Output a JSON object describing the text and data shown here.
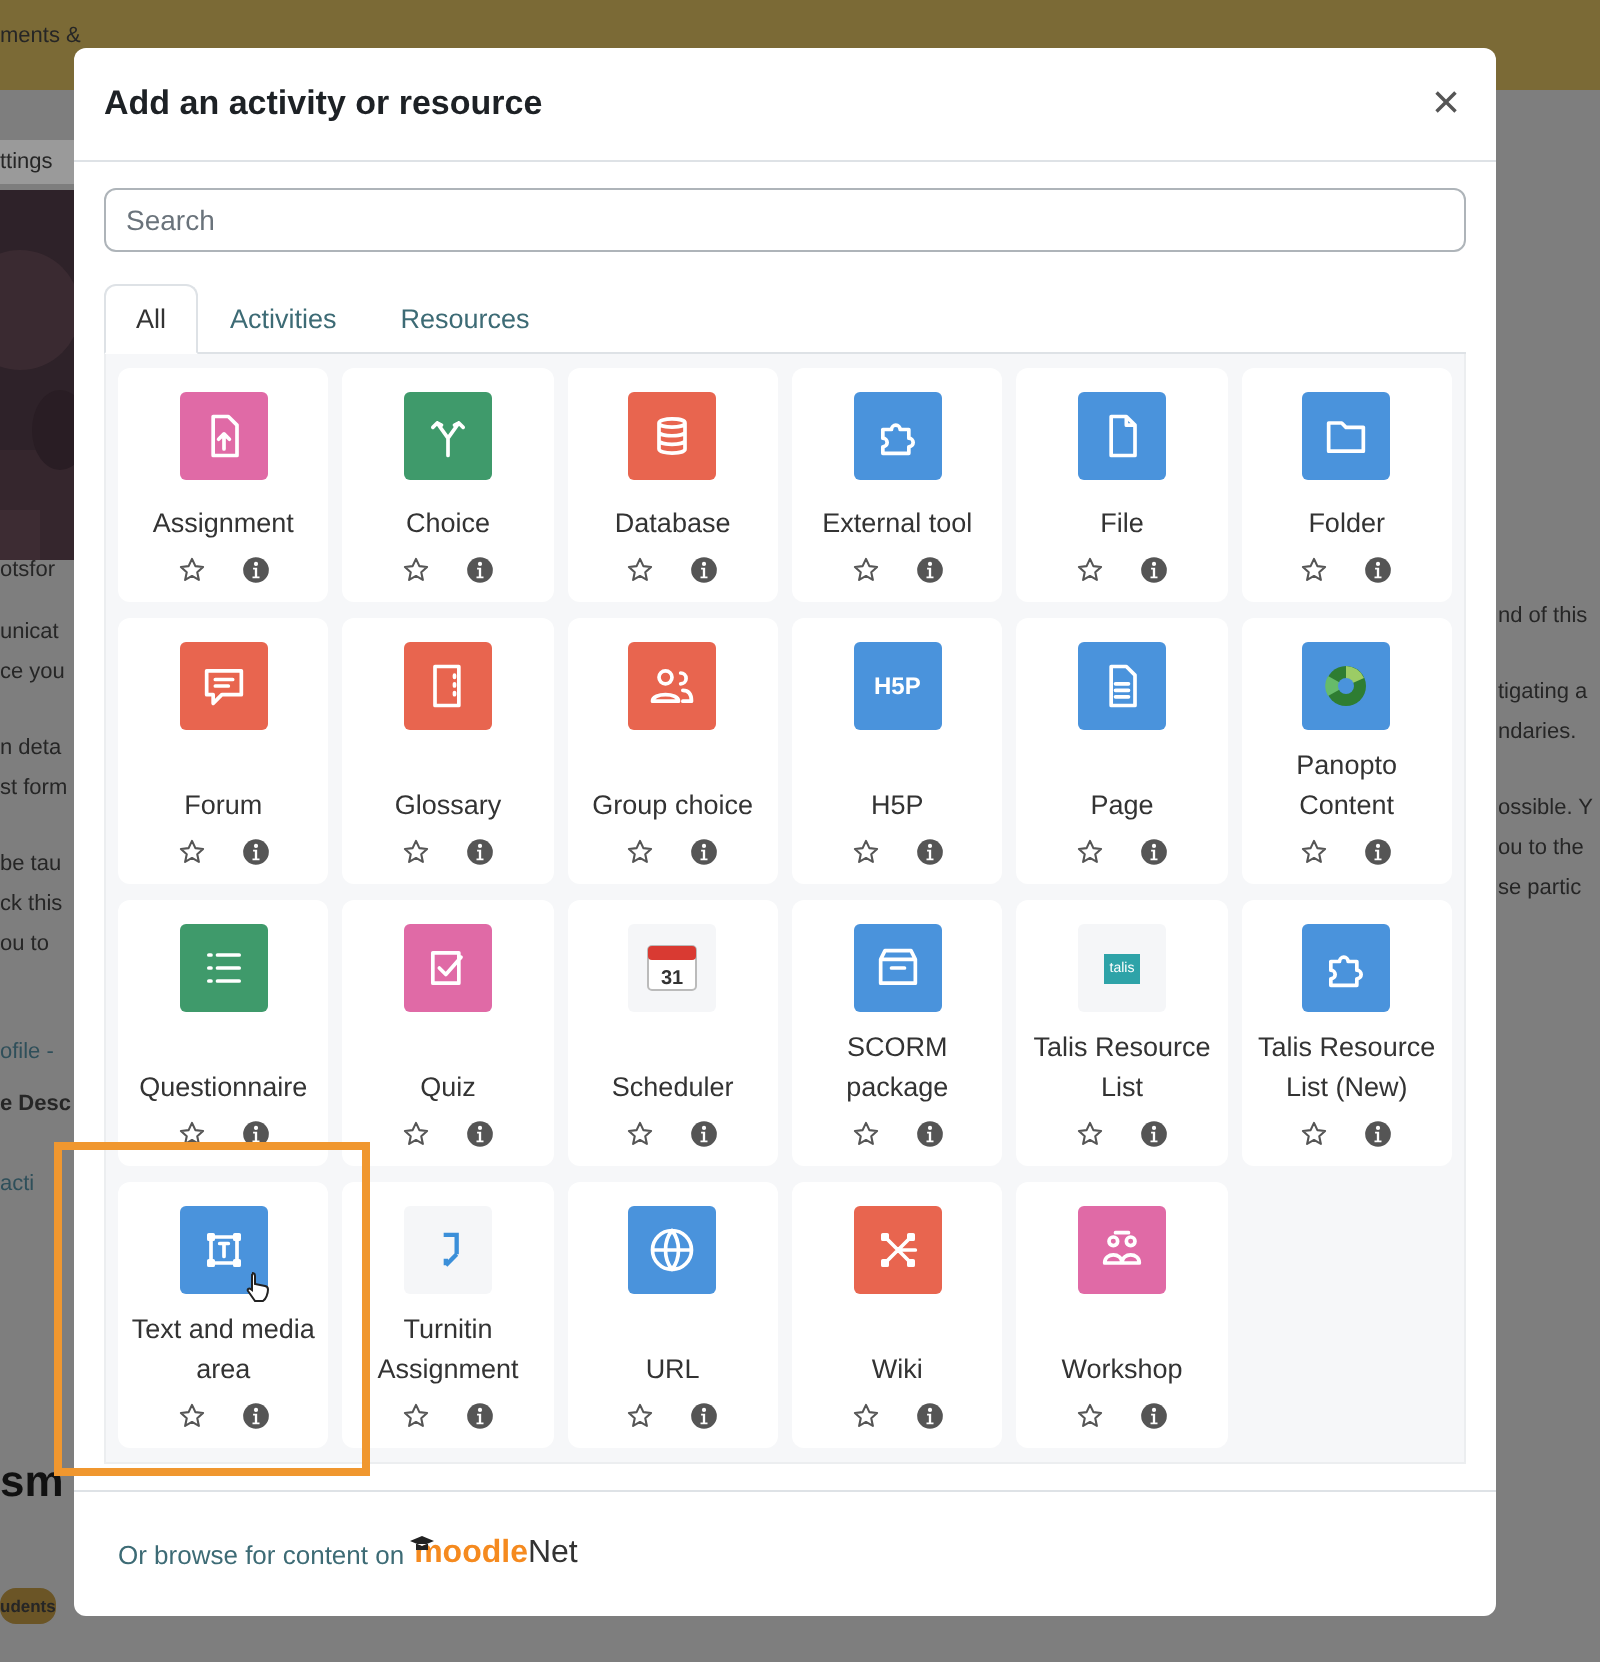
{
  "background_page": {
    "top_bar_text": "ments &",
    "left_texts": [
      "ttings",
      "otsfor",
      "unicat",
      "ce you",
      "n deta",
      "st form",
      "be tau",
      "ck this",
      "ou to",
      "ofile -",
      "e Desc",
      "acti",
      "sm",
      "udents"
    ],
    "right_texts": [
      "nd of this",
      "tigating a",
      "ndaries.",
      "ossible. Y",
      "ou to the",
      "se partic"
    ]
  },
  "dialog": {
    "title": "Add an activity or resource",
    "close": "×",
    "search": {
      "placeholder": "Search"
    },
    "tabs": [
      {
        "label": "All",
        "selected": true
      },
      {
        "label": "Activities",
        "selected": false
      },
      {
        "label": "Resources",
        "selected": false
      }
    ],
    "items": [
      {
        "label": "Assignment",
        "color": "#e06aa6",
        "starred": false,
        "highlighted": false
      },
      {
        "label": "Choice",
        "color": "#3f9a6b",
        "starred": false,
        "highlighted": false
      },
      {
        "label": "Database",
        "color": "#e8654f",
        "starred": false,
        "highlighted": false
      },
      {
        "label": "External tool",
        "color": "#4a93dc",
        "starred": false,
        "highlighted": false
      },
      {
        "label": "File",
        "color": "#4a93dc",
        "starred": false,
        "highlighted": false
      },
      {
        "label": "Folder",
        "color": "#4a93dc",
        "starred": false,
        "highlighted": false
      },
      {
        "label": "Forum",
        "color": "#e8654f",
        "starred": false,
        "highlighted": false
      },
      {
        "label": "Glossary",
        "color": "#e8654f",
        "starred": false,
        "highlighted": false
      },
      {
        "label": "Group choice",
        "color": "#e8654f",
        "starred": false,
        "highlighted": false
      },
      {
        "label": "H5P",
        "color": "#4a93dc",
        "starred": false,
        "highlighted": false,
        "icon_text": "H5P"
      },
      {
        "label": "Page",
        "color": "#4a93dc",
        "starred": false,
        "highlighted": false
      },
      {
        "label": "Panopto Content",
        "color": "#4a93dc",
        "starred": false,
        "highlighted": false
      },
      {
        "label": "Questionnaire",
        "color": "#3f9a6b",
        "starred": false,
        "highlighted": false
      },
      {
        "label": "Quiz",
        "color": "#e06aa6",
        "starred": false,
        "highlighted": false
      },
      {
        "label": "Scheduler",
        "color": "#f5f6f8",
        "starred": false,
        "highlighted": false,
        "icon_text": "31"
      },
      {
        "label": "SCORM package",
        "color": "#4a93dc",
        "starred": false,
        "highlighted": false
      },
      {
        "label": "Talis Resource List",
        "color": "#f5f6f8",
        "starred": false,
        "highlighted": false,
        "icon_text": "talis"
      },
      {
        "label": "Talis Resource List (New)",
        "color": "#4a93dc",
        "starred": false,
        "highlighted": false
      },
      {
        "label": "Text and media area",
        "color": "#4a93dc",
        "starred": false,
        "highlighted": true
      },
      {
        "label": "Turnitin Assignment",
        "color": "#f5f6f8",
        "starred": false,
        "highlighted": false
      },
      {
        "label": "URL",
        "color": "#4a93dc",
        "starred": false,
        "highlighted": false
      },
      {
        "label": "Wiki",
        "color": "#e8654f",
        "starred": false,
        "highlighted": false
      },
      {
        "label": "Workshop",
        "color": "#e06aa6",
        "starred": false,
        "highlighted": false
      }
    ],
    "footer": {
      "text": "Or browse for content on",
      "logo_parts": [
        "moodle",
        "Net"
      ]
    }
  }
}
